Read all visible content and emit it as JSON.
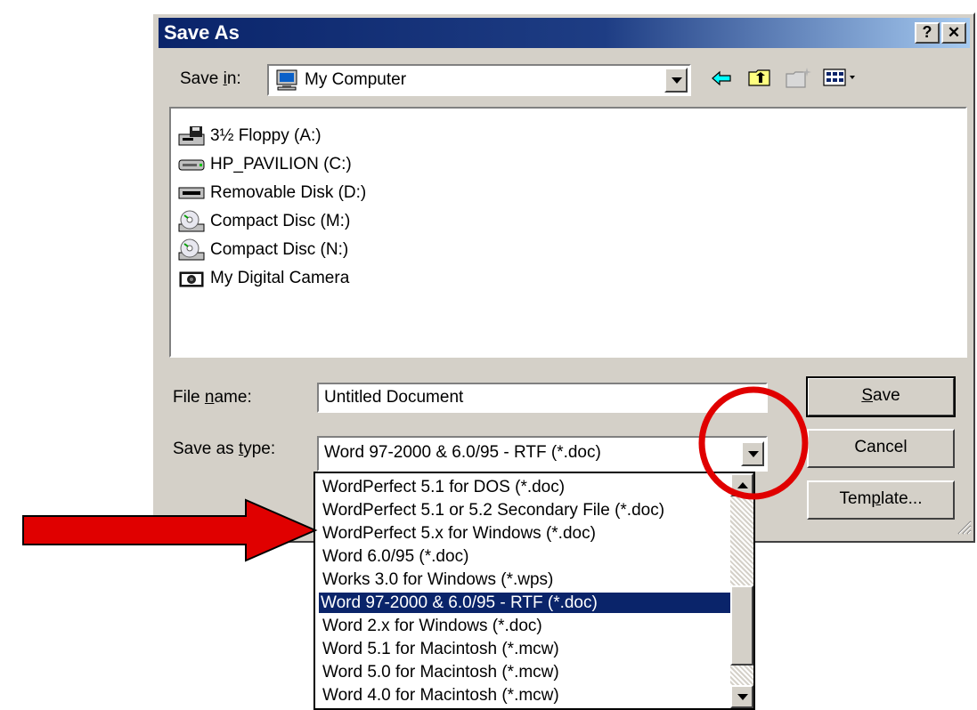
{
  "dialog": {
    "title": "Save As",
    "help_button": "?",
    "close_button": "✕"
  },
  "save_in": {
    "label_pre": "Save ",
    "label_accel": "i",
    "label_post": "n:",
    "value": "My Computer"
  },
  "toolbar_icons": [
    "back-arrow-icon",
    "up-folder-icon",
    "new-folder-icon",
    "view-menu-icon"
  ],
  "files": [
    {
      "label": "3½ Floppy (A:)",
      "icon": "floppy-drive-icon"
    },
    {
      "label": "HP_PAVILION (C:)",
      "icon": "hard-drive-icon"
    },
    {
      "label": "Removable Disk (D:)",
      "icon": "removable-disk-icon"
    },
    {
      "label": "Compact Disc (M:)",
      "icon": "cd-drive-icon"
    },
    {
      "label": "Compact Disc (N:)",
      "icon": "cd-drive-icon"
    },
    {
      "label": "My Digital Camera",
      "icon": "camera-icon"
    }
  ],
  "file_name": {
    "label_pre": "File ",
    "label_accel": "n",
    "label_post": "ame:",
    "value": "Untitled Document"
  },
  "save_as_type": {
    "label_pre": "Save as ",
    "label_accel": "t",
    "label_post": "ype:",
    "value": "Word 97-2000 & 6.0/95 - RTF (*.doc)"
  },
  "buttons": {
    "save_accel": "S",
    "save_rest": "ave",
    "cancel": "Cancel",
    "template_pre": "Tem",
    "template_accel": "p",
    "template_post": "late..."
  },
  "type_options": [
    "WordPerfect 5.1 for DOS (*.doc)",
    "WordPerfect 5.1 or 5.2 Secondary File (*.doc)",
    "WordPerfect 5.x for Windows (*.doc)",
    "Word 6.0/95 (*.doc)",
    "Works 3.0 for Windows (*.wps)",
    "Word 97-2000 & 6.0/95 - RTF (*.doc)",
    "Word 2.x for Windows (*.doc)",
    "Word 5.1 for Macintosh (*.mcw)",
    "Word 5.0 for Macintosh (*.mcw)",
    "Word 4.0 for Macintosh (*.mcw)"
  ],
  "selected_type_index": 5,
  "annotations": {
    "circle_color": "#e00000",
    "arrow_color": "#e00000"
  },
  "colors": {
    "titlebar": "#0a246a",
    "selection": "#0a246a",
    "face": "#d4d0c8"
  }
}
